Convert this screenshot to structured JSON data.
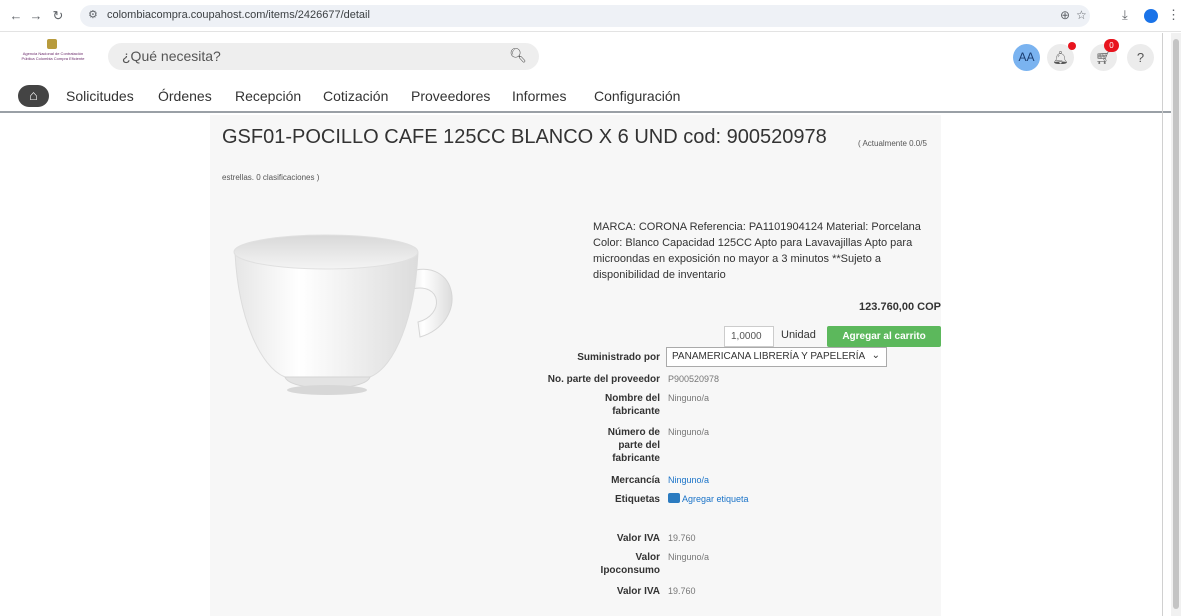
{
  "browser": {
    "url": "colombiacompra.coupahost.com/items/2426677/detail",
    "back_icon": "arrow-left-icon",
    "forward_icon": "arrow-right-icon",
    "reload_icon": "reload-icon"
  },
  "header": {
    "logo_text": "Agencia Nacional de Contratación Pública Colombia Compra Eficiente",
    "search_placeholder": "¿Qué necesita?",
    "avatar_initials": "AA",
    "cart_count": "0",
    "help_label": "?"
  },
  "menu": {
    "items": [
      "Solicitudes",
      "Órdenes",
      "Recepción",
      "Cotización",
      "Proveedores",
      "Informes",
      "Configuración"
    ]
  },
  "product": {
    "title": "GSF01-POCILLO CAFE 125CC BLANCO X 6 UND cod: 900520978",
    "rating_part1": "( Actualmente 0.0/5",
    "rating_part2": "estrellas. 0 clasificaciones )",
    "description": "MARCA: CORONA Referencia: PA1101904124 Material: Porcelana Color: Blanco Capacidad 125CC Apto para Lavavajillas Apto para microondas en exposición no mayor a 3 minutos **Sujeto a disponibilidad de inventario",
    "price": "123.760,00 COP",
    "quantity": "1,0000",
    "unit_label": "Unidad",
    "add_to_cart": "Agregar al carrito"
  },
  "details": {
    "supplier_label": "Suministrado por",
    "supplier_value": "PANAMERICANA LIBRERÍA Y PAPELERÍA",
    "supplier_part_label": "No. parte del proveedor",
    "supplier_part_value": "P900520978",
    "manufacturer_name_label": "Nombre del fabricante",
    "manufacturer_name_value": "Ninguno/a",
    "manufacturer_part_label": "Número de parte del fabricante",
    "manufacturer_part_value": "Ninguno/a",
    "commodity_label": "Mercancía",
    "commodity_value": "Ninguno/a",
    "tags_label": "Etiquetas",
    "tags_value": "Agregar etiqueta",
    "vat_label": "Valor IVA",
    "vat_value": "19.760",
    "consumption_tax_label": "Valor Ipoconsumo",
    "consumption_tax_value": "Ninguno/a",
    "vat2_label": "Valor IVA",
    "vat2_value": "19.760"
  },
  "colors": {
    "accent_green": "#5cb85c",
    "badge_red": "#e8141e",
    "avatar_blue": "#7ab3f0",
    "link_blue": "#1a73c8"
  }
}
